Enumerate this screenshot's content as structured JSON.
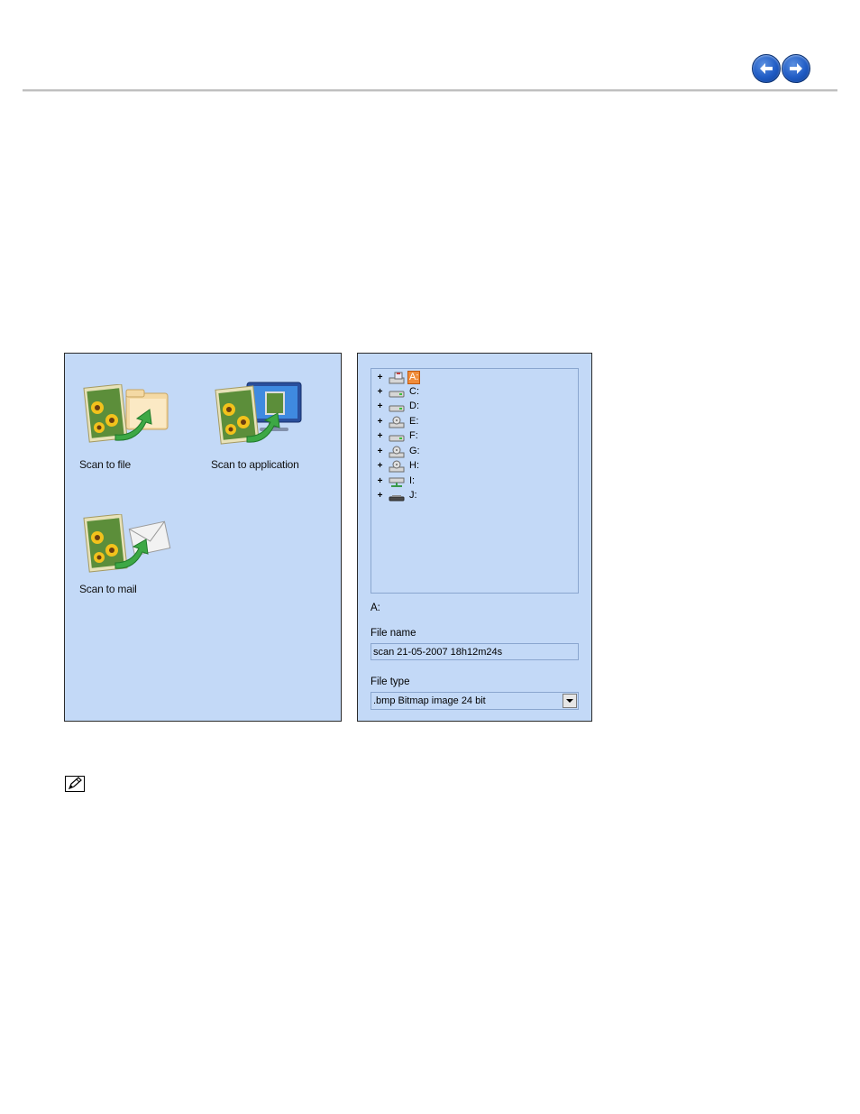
{
  "navigation": {
    "back_icon": "arrow-left-circle-icon",
    "forward_icon": "arrow-right-circle-icon"
  },
  "left_panel": {
    "items": [
      {
        "label": "Scan to file",
        "icon": "scan-to-file-icon"
      },
      {
        "label": "Scan to application",
        "icon": "scan-to-application-icon"
      },
      {
        "label": "Scan to mail",
        "icon": "scan-to-mail-icon"
      }
    ]
  },
  "right_panel": {
    "drives": [
      {
        "label": "A:",
        "icon": "floppy-drive-icon",
        "selected": true
      },
      {
        "label": "C:",
        "icon": "hard-drive-icon"
      },
      {
        "label": "D:",
        "icon": "hard-drive-icon"
      },
      {
        "label": "E:",
        "icon": "cd-drive-icon"
      },
      {
        "label": "F:",
        "icon": "hard-drive-icon"
      },
      {
        "label": "G:",
        "icon": "cd-drive-icon"
      },
      {
        "label": "H:",
        "icon": "cd-drive-icon"
      },
      {
        "label": "I:",
        "icon": "network-drive-icon"
      },
      {
        "label": "J:",
        "icon": "removable-drive-icon"
      }
    ],
    "selected_path": "A:",
    "file_name_label": "File name",
    "file_name_value": "scan 21-05-2007 18h12m24s",
    "file_type_label": "File type",
    "file_type_value": ".bmp Bitmap image 24 bit"
  },
  "note_icon": "note-pencil-icon",
  "colors": {
    "panel_background": "#c3d9f7",
    "nav_button": "#1f5bc4",
    "selection": "#f08c3a"
  }
}
